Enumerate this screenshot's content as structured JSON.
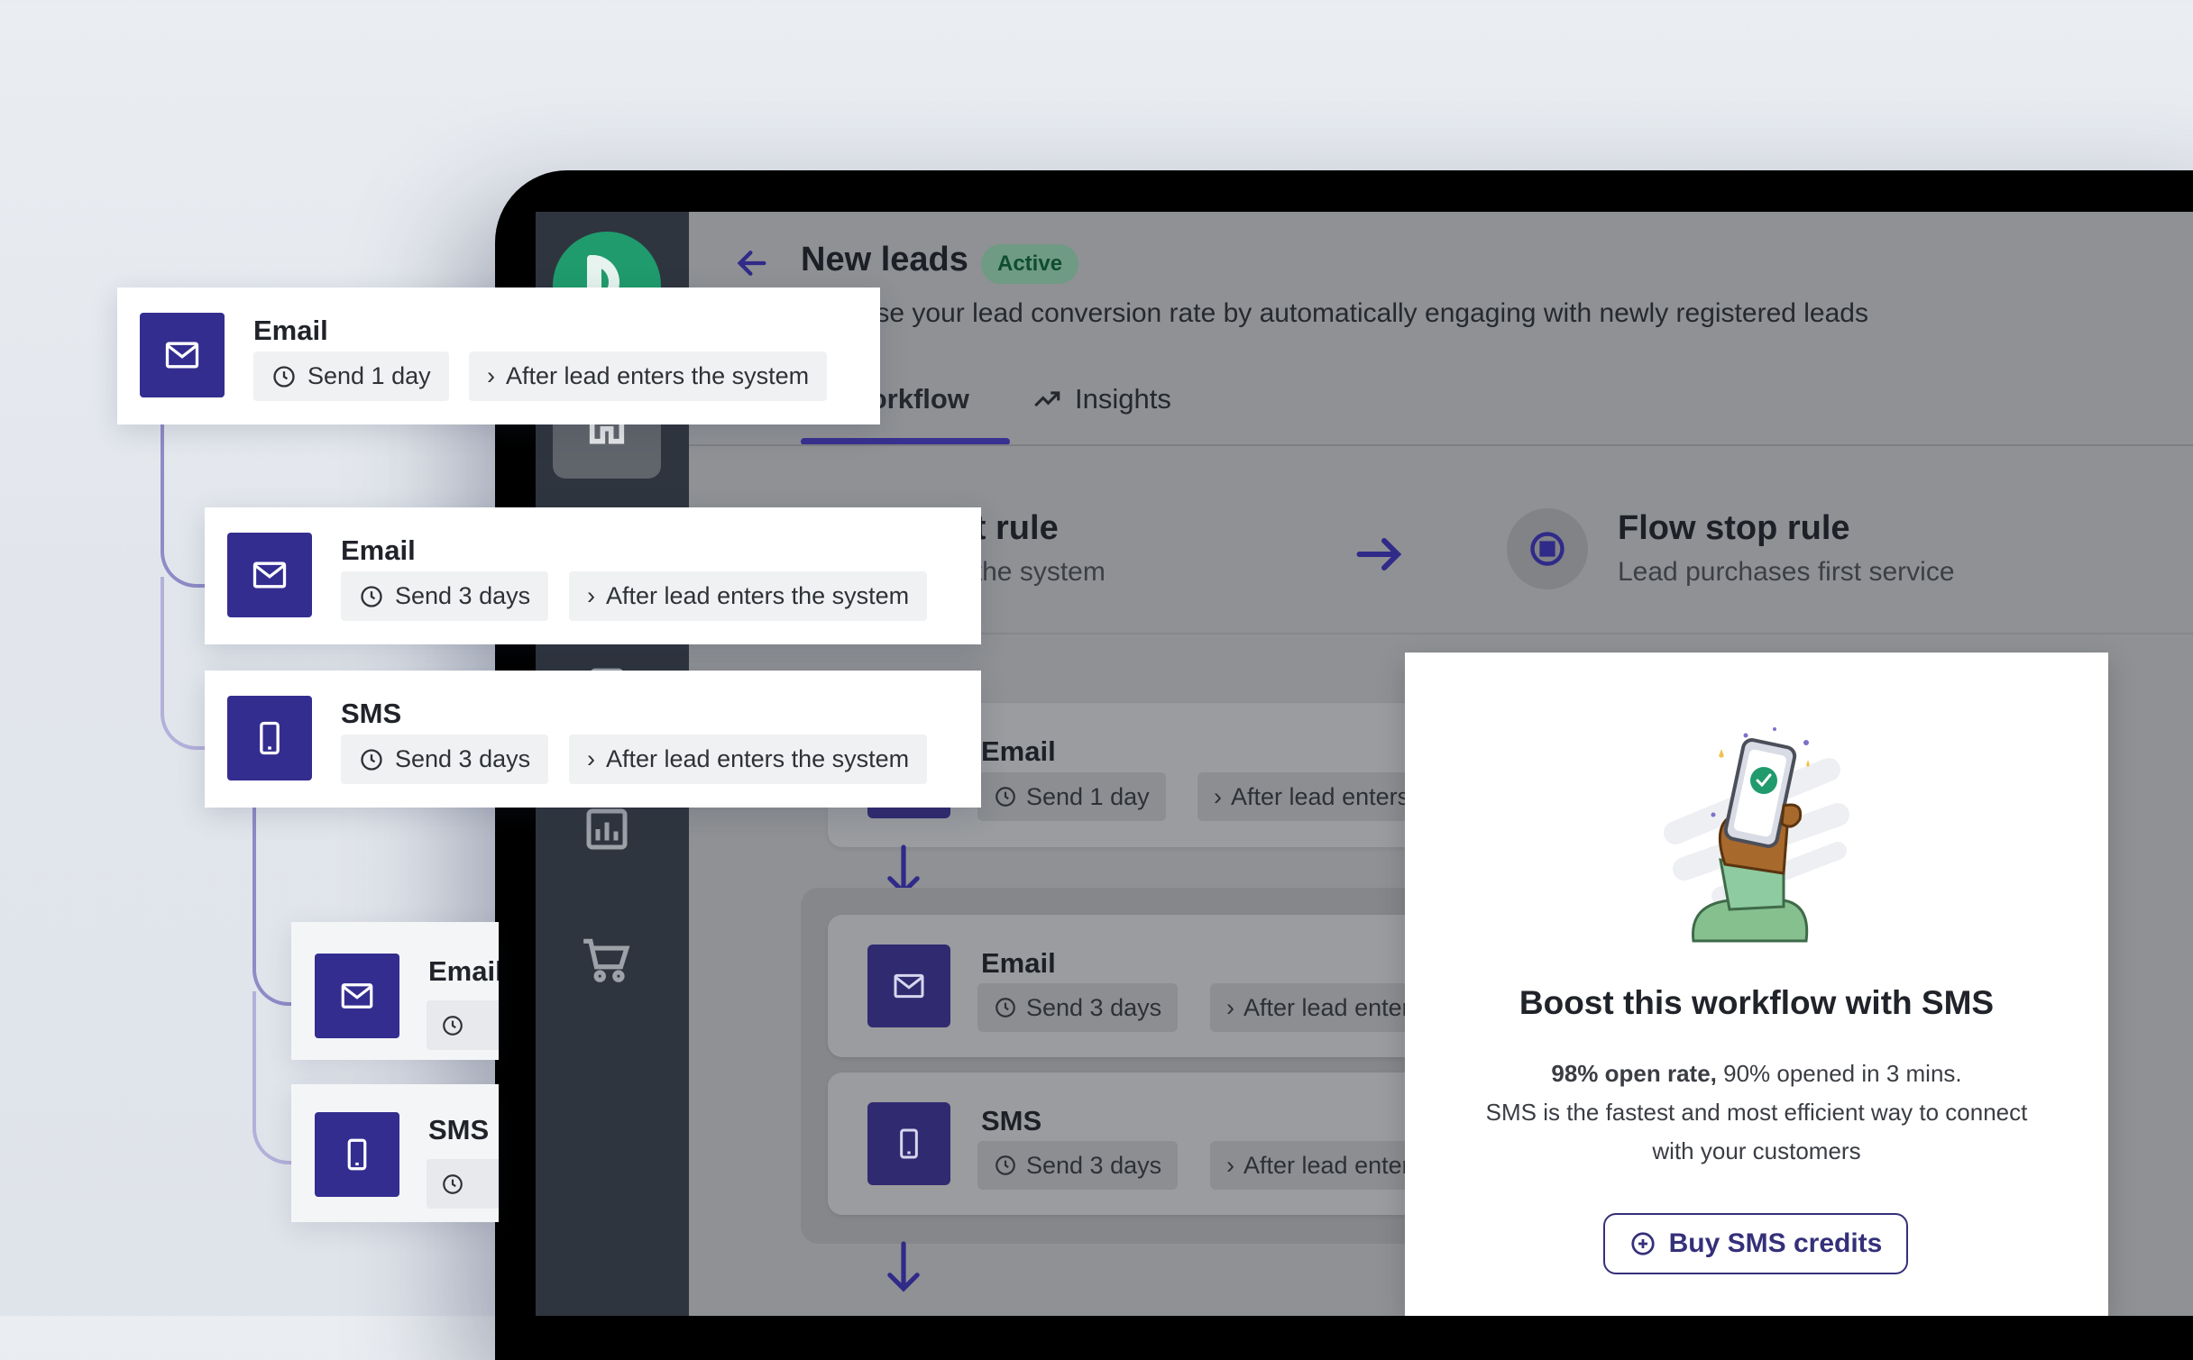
{
  "workflow": {
    "title": "New leads",
    "status": "Active",
    "description": "Increase your lead conversion rate by automatically engaging with newly registered leads"
  },
  "tabs": [
    {
      "label": "Workflow",
      "icon": "workflow-icon",
      "active": true
    },
    {
      "label": "Insights",
      "icon": "trend-icon",
      "active": false
    }
  ],
  "rules": {
    "start": {
      "title": "Flow start rule",
      "detail": "Lead enters the system"
    },
    "stop": {
      "title": "Flow stop rule",
      "detail": "Lead purchases first service"
    }
  },
  "steps": [
    {
      "channel": "Email",
      "icon": "mail-icon",
      "delay": "Send 1 day",
      "trigger": "After lead enters the system"
    },
    {
      "channel": "Email",
      "icon": "mail-icon",
      "delay": "Send 3 days",
      "trigger": "After lead enters the system"
    },
    {
      "channel": "SMS",
      "icon": "phone-icon",
      "delay": "Send 3 days",
      "trigger": "After lead enters the system"
    }
  ],
  "sidebar_icons": [
    "logo",
    "home-icon",
    "document-icon",
    "bar-chart-icon",
    "cart-icon"
  ],
  "promo": {
    "title": "Boost this workflow with SMS",
    "stat_bold": "98% open rate,",
    "stat_rest": " 90% opened in 3 mins.",
    "line2": "SMS is the fastest and most efficient way to connect",
    "line3": "with your customers",
    "button_label": "Buy SMS credits",
    "button_icon": "plus-circle-icon"
  },
  "colors": {
    "accent": "#342d90",
    "badge_active": "#1b8a57",
    "sidebar": "#2f353e"
  }
}
